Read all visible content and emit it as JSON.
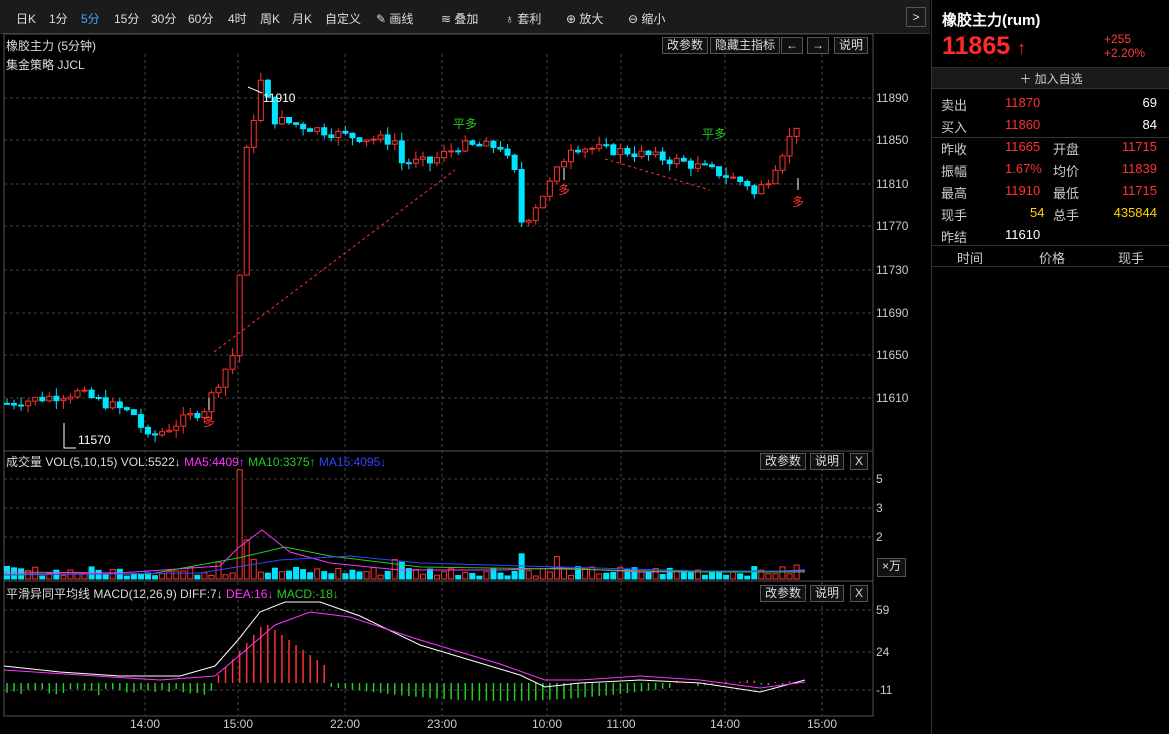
{
  "toolbar": {
    "periods": [
      "日K",
      "1分",
      "5分",
      "15分",
      "30分",
      "60分",
      "4时",
      "周K",
      "月K",
      "自定义"
    ],
    "active_period": "5分",
    "tools": [
      "画线",
      "叠加",
      "套利",
      "放大",
      "缩小"
    ],
    "expand_arrow": ">"
  },
  "main_panel": {
    "title": "橡胶主力 (5分钟)",
    "strategy": "集金策略 JJCL",
    "buttons": [
      "改参数",
      "隐藏主指标",
      "←",
      "→",
      "说明"
    ],
    "y_ticks": [
      "11890",
      "11850",
      "11810",
      "11770",
      "11730",
      "11690",
      "11650",
      "11610"
    ],
    "high_label": "11910",
    "low_label": "11570",
    "signals": {
      "buy": "多",
      "flat_buy": "平多"
    }
  },
  "volume_panel": {
    "title": "成交量 VOL(5,10,15) VOL:5522↓",
    "ma5": "MA5:4409↑",
    "ma10": "MA10:3375↑",
    "ma15": "MA15:4095↓",
    "buttons": [
      "改参数",
      "说明",
      "X"
    ],
    "y_ticks": [
      "5",
      "3",
      "2"
    ],
    "unit": "×万"
  },
  "macd_panel": {
    "title": "平滑异同平均线 MACD(12,26,9) DIFF:7↓",
    "dea": "DEA:16↓",
    "macd": "MACD:-18↓",
    "buttons": [
      "改参数",
      "说明",
      "X"
    ],
    "y_ticks": [
      "59",
      "24",
      "-11"
    ]
  },
  "time_axis": [
    "14:00",
    "15:00",
    "22:00",
    "23:00",
    "10:00",
    "11:00",
    "14:00",
    "15:00"
  ],
  "colors": {
    "up": "#ff3232",
    "down": "#00e5ff",
    "diff": "#ffffff",
    "dea": "#ff33ff",
    "ma10": "#22cc22",
    "ma15": "#3344ff",
    "accent": "#4aa3ff"
  },
  "quote": {
    "name": "橡胶主力(rum)",
    "price": "11865",
    "arrow": "↑",
    "change": "+255",
    "change_pct": "+2.20%",
    "add_watch": "加入自选",
    "sell_label": "卖出",
    "sell_price": "11870",
    "sell_vol": "69",
    "buy_label": "买入",
    "buy_price": "11860",
    "buy_vol": "84",
    "rows": [
      {
        "l1": "昨收",
        "v1": "11665",
        "l2": "开盘",
        "v2": "11715"
      },
      {
        "l1": "振幅",
        "v1": "1.67%",
        "l2": "均价",
        "v2": "11839"
      },
      {
        "l1": "最高",
        "v1": "11910",
        "l2": "最低",
        "v2": "11715"
      },
      {
        "l1": "现手",
        "v1": "54",
        "l2": "总手",
        "v2": "435844"
      },
      {
        "l1": "昨结",
        "v1": "11610",
        "l2": "",
        "v2": ""
      }
    ],
    "tick_headers": [
      "时间",
      "价格",
      "现手"
    ]
  }
}
